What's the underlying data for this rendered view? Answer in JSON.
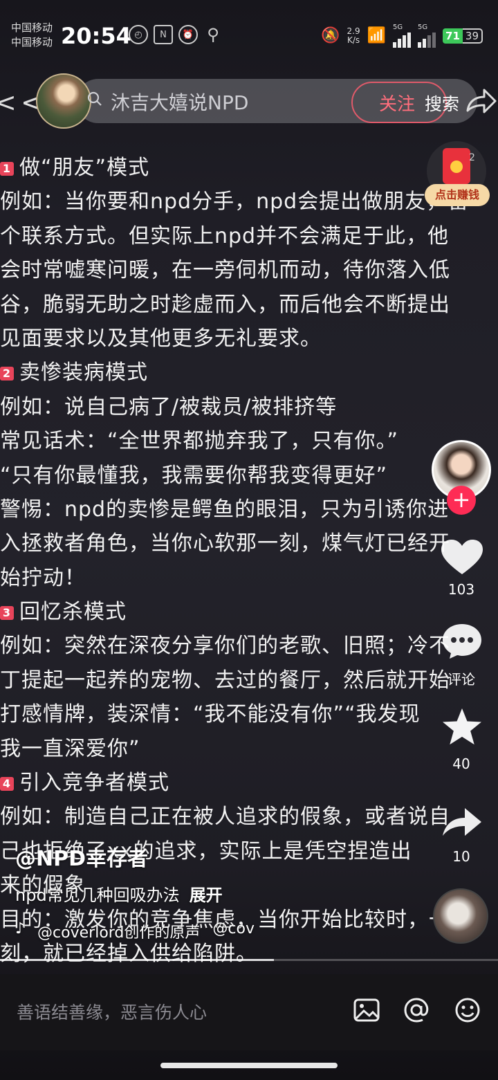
{
  "status_bar": {
    "carrier_1": "中国移动",
    "carrier_2": "中国移动",
    "time": "20:54",
    "network_speed_value": "2.9",
    "network_speed_unit": "K/s",
    "signal_1": "5G",
    "signal_2": "5G",
    "battery_level": "71",
    "battery_extra": "39"
  },
  "top_bar": {
    "search_text": "沐吉大嬉说NPD",
    "follow_label": "关注",
    "search_label": "搜索"
  },
  "post_lines": [
    {
      "num": "1",
      "text": "做“朋友”模式"
    },
    {
      "num": "",
      "text": "例如：当你要和npd分手，npd会提出做朋友，留"
    },
    {
      "num": "",
      "text": "个联系方式。但实际上npd并不会满足于此，他"
    },
    {
      "num": "",
      "text": "会时常嘘寒问暖，在一旁伺机而动，待你落入低"
    },
    {
      "num": "",
      "text": "谷，脆弱无助之时趁虚而入，而后他会不断提出"
    },
    {
      "num": "",
      "text": "见面要求以及其他更多无礼要求。"
    },
    {
      "num": "2",
      "text": "卖惨装病模式"
    },
    {
      "num": "",
      "text": "例如：说自己病了/被裁员/被排挤等"
    },
    {
      "num": "",
      "text": "常见话术：“全世界都抛弃我了，只有你。”"
    },
    {
      "num": "",
      "text": "“只有你最懂我，我需要你帮我变得更好”"
    },
    {
      "num": "",
      "text": "警惕：npd的卖惨是鳄鱼的眼泪，只为引诱你进"
    },
    {
      "num": "",
      "text": "入拯救者角色，当你心软那一刻，煤气灯已经开"
    },
    {
      "num": "",
      "text": "始拧动！"
    },
    {
      "num": "3",
      "text": "回忆杀模式"
    },
    {
      "num": "",
      "text": "例如：突然在深夜分享你们的老歌、旧照；冷不"
    },
    {
      "num": "",
      "text": "丁提起一起养的宠物、去过的餐厅，然后就开始"
    },
    {
      "num": "",
      "text": "打感情牌，装深情：“我不能没有你”“我发现"
    },
    {
      "num": "",
      "text": "我一直深爱你”"
    },
    {
      "num": "4",
      "text": "引入竞争者模式"
    },
    {
      "num": "",
      "text": "例如：制造自己正在被人追求的假象，或者说自"
    },
    {
      "num": "",
      "text": "己也拒绝了xx的追求，实际上是凭空捏造出"
    },
    {
      "num": "",
      "text": "来的假象"
    },
    {
      "num": "",
      "text": "目的：激发你的竞争焦虑，当你开始比较时，一"
    },
    {
      "num": "",
      "text": "刻，就已经掉入供给陷阱。"
    }
  ],
  "right_rail": {
    "earn_label": "点击赚钱",
    "red_packet_badge": "2",
    "like_count": "103",
    "comment_label": "评论",
    "favorite_count": "40",
    "share_count": "10"
  },
  "caption": {
    "username": "@NPD幸存者",
    "description": "npd常见几种回吸办法",
    "expand": "展开",
    "music": "@coverlord创作的原声",
    "music_author": "@cov"
  },
  "progress_fraction": 0.55,
  "comment_bar": {
    "placeholder": "善语结善缘，恶言伤人心"
  }
}
